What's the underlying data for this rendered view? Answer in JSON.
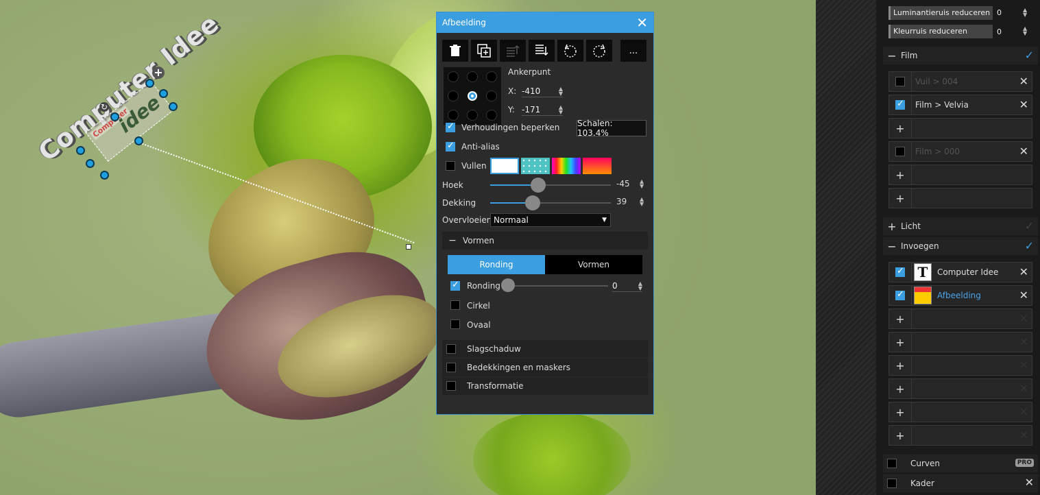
{
  "canvas": {
    "watermark_text": "Computer Idee",
    "watermark_image_top": "Computer",
    "watermark_image_bottom": "idee"
  },
  "dialog": {
    "title": "Afbeelding",
    "close_icon": "✕",
    "toolbar": [
      {
        "name": "delete",
        "icon": "trash-icon",
        "glyph": "🗑"
      },
      {
        "name": "duplicate",
        "icon": "duplicate-icon",
        "glyph": "⧉"
      },
      {
        "name": "move-up",
        "icon": "move-up-icon",
        "glyph": "≡"
      },
      {
        "name": "move-down",
        "icon": "move-down-icon",
        "glyph": "≡"
      },
      {
        "name": "rotate-left",
        "icon": "rotate-left-icon",
        "glyph": "↺"
      },
      {
        "name": "rotate-right",
        "icon": "rotate-right-icon",
        "glyph": "↻"
      },
      {
        "name": "more",
        "icon": "more-icon",
        "glyph": "..."
      }
    ],
    "anchor_label": "Ankerpunt",
    "x_label": "X:",
    "x_value": "-410",
    "y_label": "Y:",
    "y_value": "-171",
    "keep_ratio_label": "Verhoudingen beperken",
    "scale_text": "Schalen: 103.4%",
    "antialias_label": "Anti-alias",
    "fill_label": "Vullen",
    "angle_label": "Hoek",
    "angle_value": "-45",
    "angle_fraction": 0.4,
    "opacity_label": "Dekking",
    "opacity_value": "39",
    "opacity_fraction": 0.35,
    "blend_label": "Overvloeien",
    "blend_value": "Normaal",
    "shapes_section": "Vormen",
    "tab_rounding": "Ronding",
    "tab_shapes": "Vormen",
    "rounding_label": "Ronding",
    "rounding_value": "0",
    "circle_label": "Cirkel",
    "oval_label": "Ovaal",
    "shadow_label": "Slagschaduw",
    "masks_label": "Bedekkingen en maskers",
    "transform_label": "Transformatie"
  },
  "panel": {
    "lum_noise_label": "Luminantieruis reduceren",
    "lum_noise_value": "0",
    "color_noise_label": "Kleurruis reduceren",
    "color_noise_value": "0",
    "film_header": "Film",
    "film_items": [
      "Vuil > 004",
      "Film > Velvia",
      "Film > 000"
    ],
    "light_header": "Licht",
    "insert_header": "Invoegen",
    "insert_items": [
      "Computer Idee",
      "Afbeelding"
    ],
    "curves_label": "Curven",
    "curves_badge": "PRO",
    "frame_label": "Kader"
  },
  "colors": {
    "accent": "#3b9ee0",
    "dialog_bg": "#2b2b2b",
    "panel_bg": "#1a1a1a"
  }
}
